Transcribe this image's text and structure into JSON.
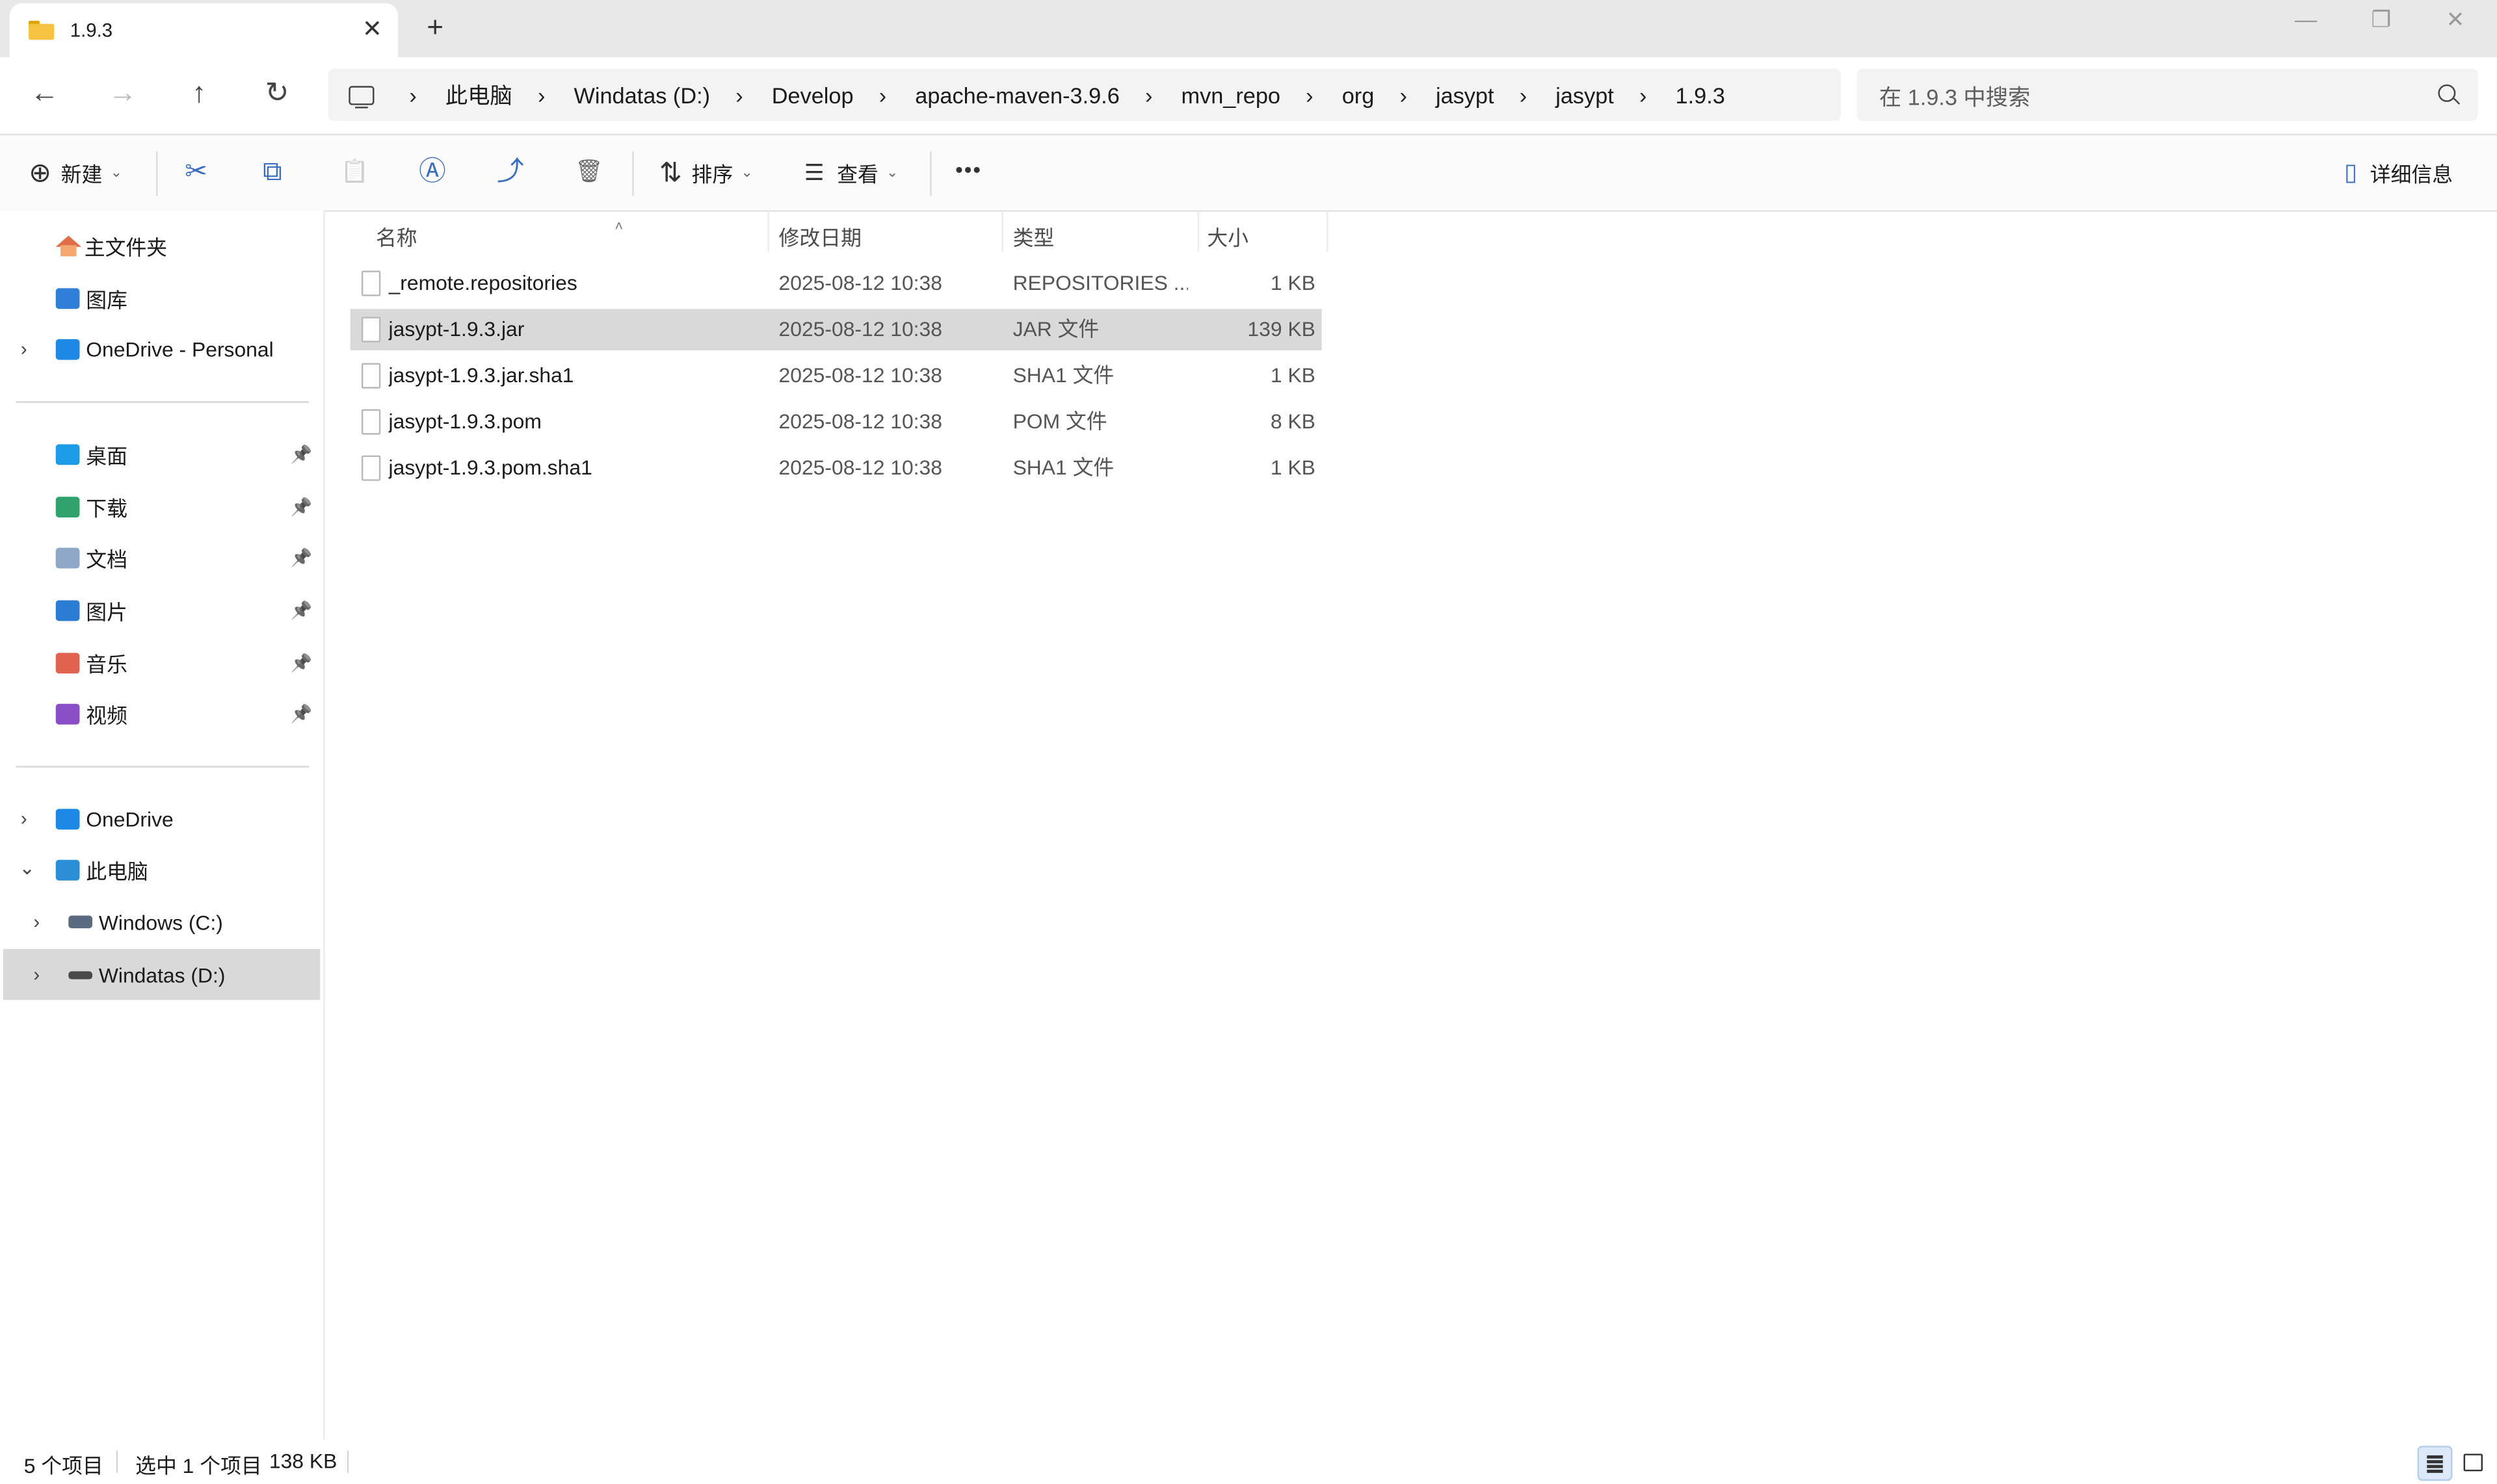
{
  "window": {
    "tab_title": "1.9.3",
    "tab_close": "✕",
    "new_tab": "+",
    "minimize": "—",
    "maximize": "❐",
    "close": "✕"
  },
  "nav": {
    "back": "←",
    "forward": "→",
    "up": "↑",
    "refresh": "↻",
    "breadcrumbs": [
      "此电脑",
      "Windatas (D:)",
      "Develop",
      "apache-maven-3.9.6",
      "mvn_repo",
      "org",
      "jasypt",
      "jasypt",
      "1.9.3"
    ],
    "sep": "›",
    "search_placeholder": "在 1.9.3 中搜索"
  },
  "toolbar": {
    "new_icon": "⊕",
    "new_label": "新建",
    "cut_icon": "✂",
    "copy_icon": "⧉",
    "paste_icon": "📋",
    "rename_icon": "Ⓐ",
    "share_icon": "⤴",
    "delete_icon": "🗑",
    "sort_icon": "⇅",
    "sort_label": "排序",
    "view_icon": "☰",
    "view_label": "查看",
    "more_icon": "•••",
    "details_icon": "▯",
    "details_label": "详细信息",
    "caret": "⌄"
  },
  "sidebar": {
    "home": "主文件夹",
    "gallery": "图库",
    "onedrive_personal": "OneDrive - Personal",
    "desktop": "桌面",
    "downloads": "下载",
    "documents": "文档",
    "pictures": "图片",
    "music": "音乐",
    "videos": "视频",
    "onedrive": "OneDrive",
    "this_pc": "此电脑",
    "drive_c": "Windows (C:)",
    "drive_d": "Windatas (D:)",
    "chev_right": "›",
    "chev_down": "⌄",
    "pin": "📌"
  },
  "columns": {
    "name": "名称",
    "modified": "修改日期",
    "type": "类型",
    "size": "大小",
    "sort_indicator": "˄"
  },
  "files": [
    {
      "name": "_remote.repositories",
      "modified": "2025-08-12 10:38",
      "type": "REPOSITORIES ...",
      "size": "1 KB"
    },
    {
      "name": "jasypt-1.9.3.jar",
      "modified": "2025-08-12 10:38",
      "type": "JAR 文件",
      "size": "139 KB"
    },
    {
      "name": "jasypt-1.9.3.jar.sha1",
      "modified": "2025-08-12 10:38",
      "type": "SHA1 文件",
      "size": "1 KB"
    },
    {
      "name": "jasypt-1.9.3.pom",
      "modified": "2025-08-12 10:38",
      "type": "POM 文件",
      "size": "8 KB"
    },
    {
      "name": "jasypt-1.9.3.pom.sha1",
      "modified": "2025-08-12 10:38",
      "type": "SHA1 文件",
      "size": "1 KB"
    }
  ],
  "status": {
    "item_count": "5 个项目",
    "selection": "选中 1 个项目",
    "selection_size": "138 KB"
  },
  "colors": {
    "accent": "#3b6dbe",
    "selected_row": "#d9d9d9",
    "folder": "#f5c242"
  }
}
